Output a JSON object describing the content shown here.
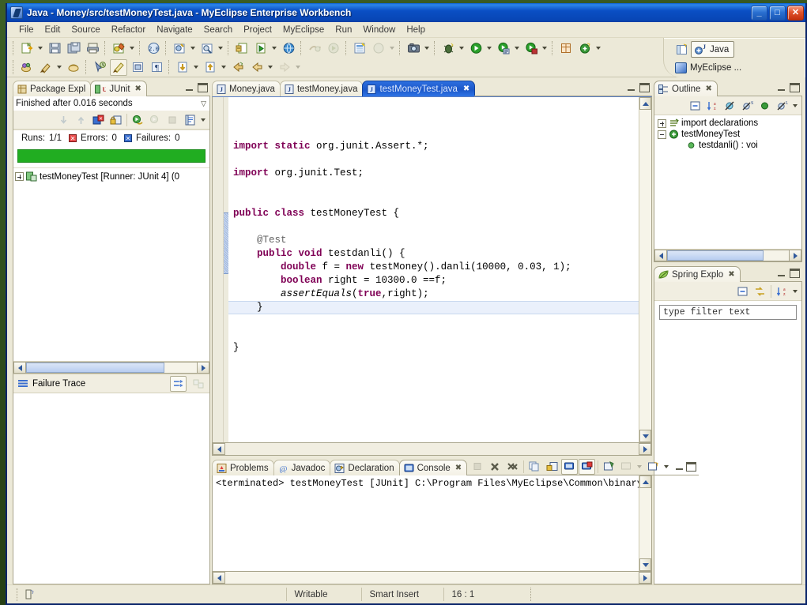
{
  "window": {
    "title": "Java - Money/src/testMoneyTest.java - MyEclipse Enterprise Workbench",
    "minimize_label": "_",
    "maximize_label": "□",
    "close_label": "✕"
  },
  "menubar": {
    "items": [
      "File",
      "Edit",
      "Source",
      "Refactor",
      "Navigate",
      "Search",
      "Project",
      "MyEclipse",
      "Run",
      "Window",
      "Help"
    ]
  },
  "perspective": {
    "java_label": "Java",
    "myeclipse_label": "MyEclipse ..."
  },
  "junit": {
    "tabs": [
      {
        "label": "Package Expl",
        "icon": "package-explorer-icon",
        "active": false
      },
      {
        "label": "JUnit",
        "icon": "junit-icon",
        "active": true
      }
    ],
    "status": "Finished after 0.016 seconds",
    "runs_label": "Runs:",
    "runs_value": "1/1",
    "errors_label": "Errors:",
    "errors_value": "0",
    "failures_label": "Failures:",
    "failures_value": "0",
    "progress_color": "#21ad21",
    "tree_item": "testMoneyTest  [Runner: JUnit 4]  (0",
    "failure_trace_label": "Failure Trace"
  },
  "editor": {
    "tabs": [
      {
        "label": "Money.java",
        "active": false
      },
      {
        "label": "testMoney.java",
        "active": false
      },
      {
        "label": "testMoneyTest.java",
        "active": true
      }
    ],
    "code_lines": [
      {
        "indent": 0,
        "parts": [
          {
            "t": "import ",
            "c": "kw"
          },
          {
            "t": "static ",
            "c": "kw"
          },
          {
            "t": "org.junit.Assert.*;",
            "c": ""
          }
        ]
      },
      {
        "indent": 0,
        "parts": []
      },
      {
        "indent": 0,
        "parts": [
          {
            "t": "import ",
            "c": "kw"
          },
          {
            "t": "org.junit.Test;",
            "c": ""
          }
        ]
      },
      {
        "indent": 0,
        "parts": []
      },
      {
        "indent": 0,
        "parts": []
      },
      {
        "indent": 0,
        "parts": [
          {
            "t": "public ",
            "c": "kw"
          },
          {
            "t": "class ",
            "c": "kw"
          },
          {
            "t": "testMoneyTest {",
            "c": ""
          }
        ]
      },
      {
        "indent": 0,
        "parts": []
      },
      {
        "indent": 1,
        "parts": [
          {
            "t": "@Test",
            "c": "ann"
          }
        ]
      },
      {
        "indent": 1,
        "parts": [
          {
            "t": "public ",
            "c": "kw"
          },
          {
            "t": "void ",
            "c": "kw"
          },
          {
            "t": "testdanli() {",
            "c": ""
          }
        ]
      },
      {
        "indent": 2,
        "parts": [
          {
            "t": "double ",
            "c": "kw"
          },
          {
            "t": "f = ",
            "c": ""
          },
          {
            "t": "new ",
            "c": "kw"
          },
          {
            "t": "testMoney().danli(10000, 0.03, 1);",
            "c": ""
          }
        ]
      },
      {
        "indent": 2,
        "parts": [
          {
            "t": "boolean ",
            "c": "kw"
          },
          {
            "t": "right = 10300.0 ==f;",
            "c": ""
          }
        ]
      },
      {
        "indent": 2,
        "parts": [
          {
            "t": "assertEquals",
            "c": "st"
          },
          {
            "t": "(",
            "c": ""
          },
          {
            "t": "true",
            "c": "kw"
          },
          {
            "t": ",right);",
            "c": ""
          }
        ]
      },
      {
        "indent": 1,
        "parts": [
          {
            "t": "}",
            "c": ""
          }
        ]
      },
      {
        "indent": 0,
        "parts": []
      },
      {
        "indent": 0,
        "parts": []
      },
      {
        "indent": 0,
        "parts": [
          {
            "t": "}",
            "c": ""
          }
        ]
      }
    ]
  },
  "outline": {
    "tab_label": "Outline",
    "items": [
      {
        "label": "import declarations",
        "icon": "import-declarations-icon",
        "depth": 0,
        "twisty": "plus"
      },
      {
        "label": "testMoneyTest",
        "icon": "class-icon",
        "depth": 0,
        "twisty": "minus"
      },
      {
        "label": "testdanli() : voi",
        "icon": "method-icon",
        "depth": 1,
        "twisty": "none"
      }
    ]
  },
  "spring": {
    "tab_label": "Spring Explo",
    "filter_placeholder": "type filter text"
  },
  "console": {
    "tabs": [
      {
        "label": "Problems",
        "icon": "problems-icon",
        "active": false
      },
      {
        "label": "Javadoc",
        "icon": "javadoc-icon",
        "active": false
      },
      {
        "label": "Declaration",
        "icon": "declaration-icon",
        "active": false
      },
      {
        "label": "Console",
        "icon": "console-icon",
        "active": true
      }
    ],
    "output": "<terminated> testMoneyTest [JUnit] C:\\Program Files\\MyEclipse\\Common\\binary\\com.sun.java.jdk.win32.x86_1.6.0.013\\bin\\javaw.ex"
  },
  "statusbar": {
    "writable": "Writable",
    "insert_mode": "Smart Insert",
    "position": "16 : 1"
  }
}
